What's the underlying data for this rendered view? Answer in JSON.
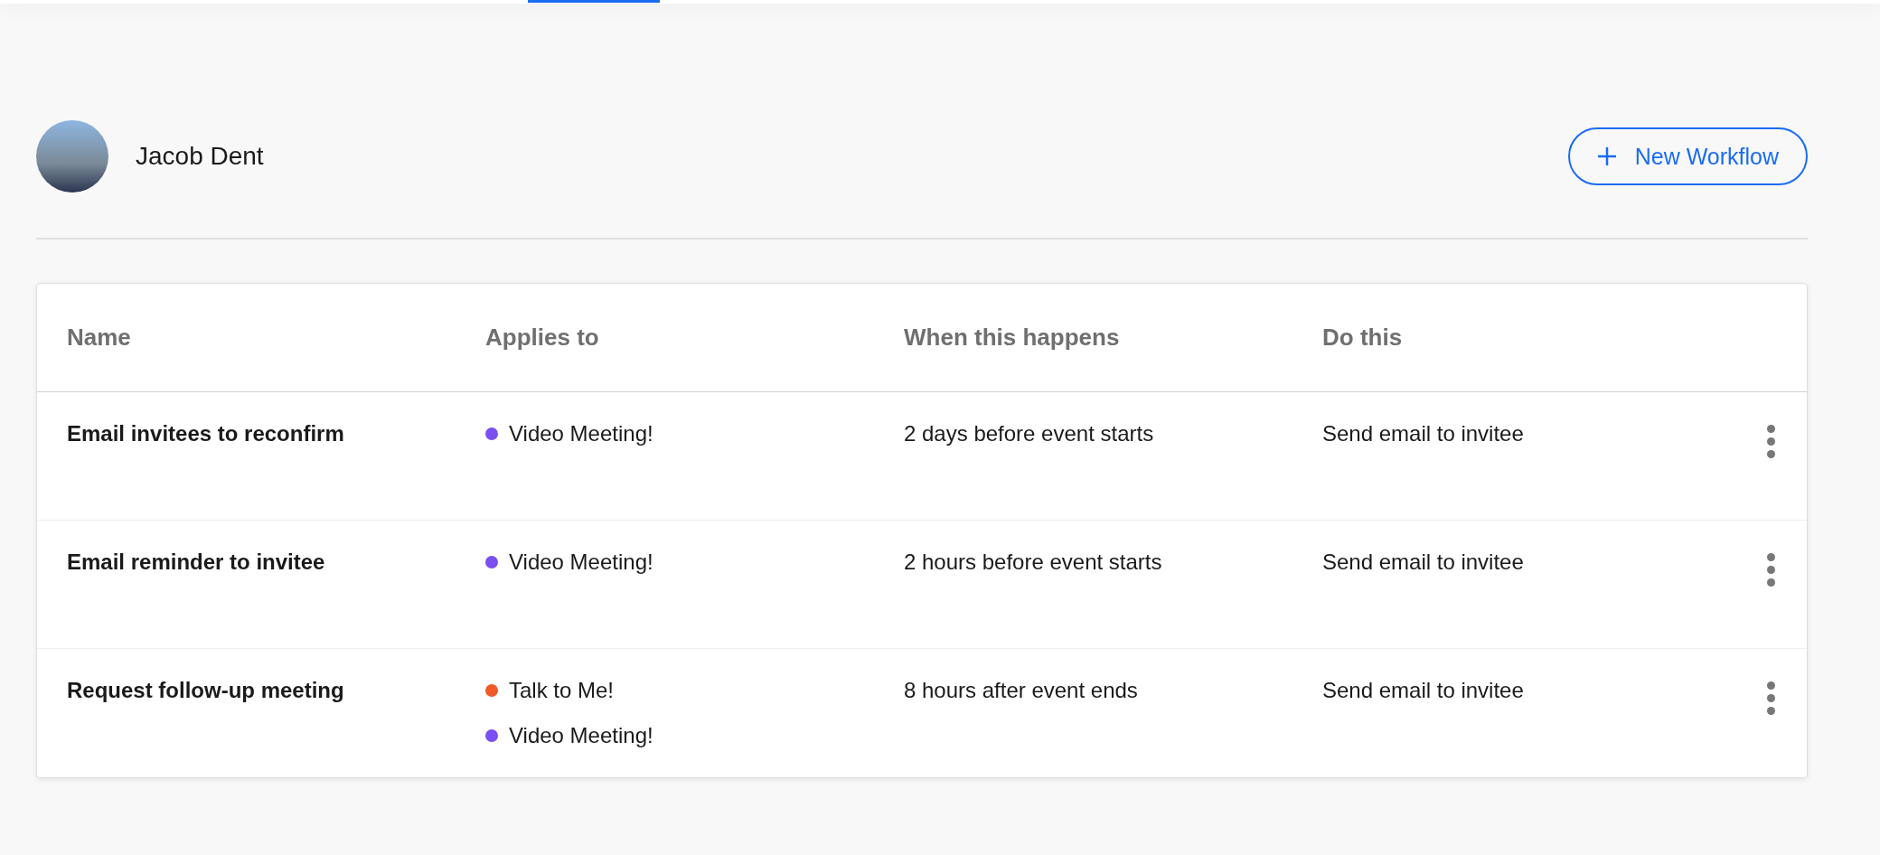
{
  "user": {
    "name": "Jacob Dent"
  },
  "new_button": {
    "label": "New Workflow"
  },
  "table": {
    "columns": [
      "Name",
      "Applies to",
      "When this happens",
      "Do this"
    ],
    "rows": [
      {
        "name": "Email invitees to reconfirm",
        "applies_to": [
          {
            "label": "Video Meeting!",
            "color": "#7b4ff0"
          }
        ],
        "when": "2 days before event starts",
        "action": "Send email to invitee"
      },
      {
        "name": "Email reminder to invitee",
        "applies_to": [
          {
            "label": "Video Meeting!",
            "color": "#7b4ff0"
          }
        ],
        "when": "2 hours before event starts",
        "action": "Send email to invitee"
      },
      {
        "name": "Request follow-up meeting",
        "applies_to": [
          {
            "label": "Talk to Me!",
            "color": "#f05a28"
          },
          {
            "label": "Video Meeting!",
            "color": "#7b4ff0"
          }
        ],
        "when": "8 hours after event ends",
        "action": "Send email to invitee"
      }
    ]
  }
}
